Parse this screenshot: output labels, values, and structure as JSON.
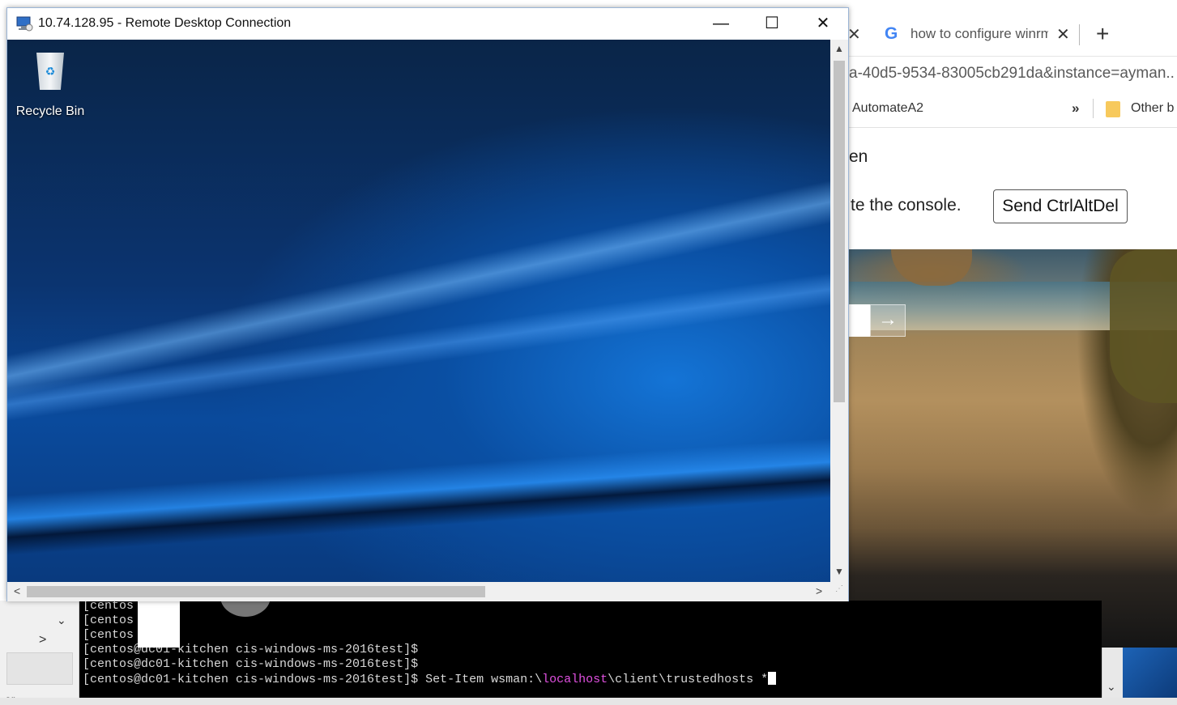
{
  "rdp": {
    "title": "10.74.128.95 - Remote Desktop Connection",
    "minimize": "—",
    "maximize": "☐",
    "close": "✕",
    "desktop_icon_label": "Recycle Bin"
  },
  "browser": {
    "prev_tab_close": "✕",
    "tab_title": "how to configure winrm",
    "tab_close": "✕",
    "new_tab": "+",
    "url_fragment": "a-40d5-9534-83005cb291da&instance=ayman..",
    "bookmark": "AutomateA2",
    "bookmark_overflow": "»",
    "bookmark_other": "Other b",
    "page_heading_fragment": "en",
    "page_message_fragment": "te the console.",
    "send_ctrl_alt_del": "Send CtrlAltDel",
    "login_arrow": "→"
  },
  "left_panel": {
    "chevron_down": "⌄",
    "chevron_right": ">",
    "bottom_text": "er"
  },
  "terminal": {
    "lines": [
      "[centos",
      "[centos",
      "[centos",
      "[centos@dc01-kitchen cis-windows-ms-2016test]$",
      "[centos@dc01-kitchen cis-windows-ms-2016test]$"
    ],
    "cmd_prompt": "[centos@dc01-kitchen cis-windows-ms-2016test]$ Set-Item wsman:\\",
    "cmd_highlight": "localhost",
    "cmd_rest": "\\client\\trustedhosts *"
  }
}
